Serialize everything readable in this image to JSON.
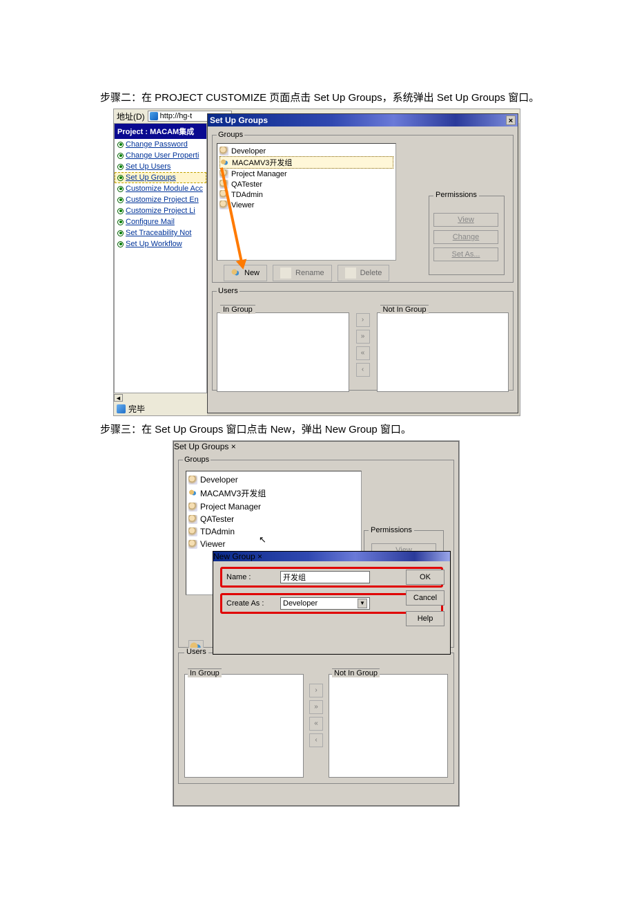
{
  "step2_text": "步骤二：在 PROJECT CUSTOMIZE 页面点击 Set Up Groups，系统弹出 Set Up Groups 窗口。",
  "step3_text": "步骤三：在 Set Up Groups 窗口点击 New，弹出 New Group 窗口。",
  "s1": {
    "addr_label": "地址(D)",
    "addr_value": "http://hg-t",
    "project_header": "Project : MACAM集成",
    "sidebar": [
      "Change Password",
      "Change User Properti",
      "Set Up Users",
      "Set Up Groups",
      "Customize Module Acc",
      "Customize Project En",
      "Customize Project Li",
      "Configure Mail",
      "Set Traceability Not",
      "Set Up Workflow"
    ],
    "status": "完毕",
    "dialog_title": "Set Up Groups",
    "groups_legend": "Groups",
    "groups": [
      "Developer",
      "MACAMV3开发组",
      "Project Manager",
      "QATester",
      "TDAdmin",
      "Viewer"
    ],
    "perm_legend": "Permissions",
    "perm_btns": [
      "View",
      "Change",
      "Set As..."
    ],
    "row_btns": [
      "New",
      "Rename",
      "Delete"
    ],
    "users_legend": "Users",
    "in_group": "In Group",
    "not_in_group": "Not In Group"
  },
  "s2": {
    "dialog_title": "Set Up Groups",
    "groups_legend": "Groups",
    "groups": [
      "Developer",
      "MACAMV3开发组",
      "Project Manager",
      "QATester",
      "TDAdmin",
      "Viewer"
    ],
    "perm_legend": "Permissions",
    "perm_btns": [
      "View"
    ],
    "newdlg_title": "New Group",
    "name_lbl": "Name :",
    "name_val": "开发组",
    "createas_lbl": "Create As :",
    "createas_val": "Developer",
    "ok": "OK",
    "cancel": "Cancel",
    "help": "Help",
    "users_legend": "Users",
    "in_group": "In Group",
    "not_in_group": "Not In Group"
  }
}
